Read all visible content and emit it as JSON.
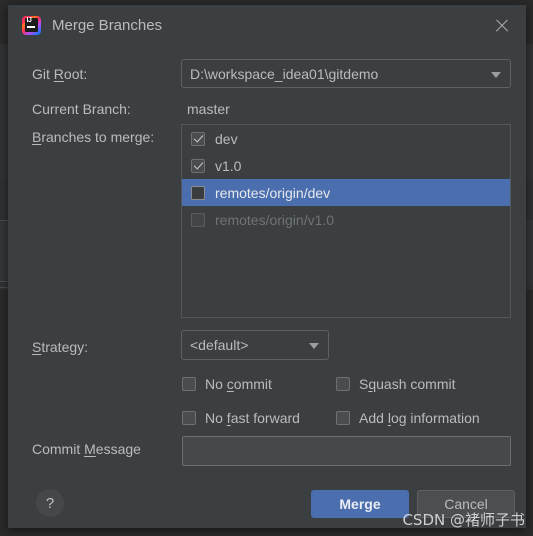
{
  "dialog": {
    "title": "Merge Branches",
    "icon": "intellij-idea-icon",
    "close_icon": "close-icon",
    "help_label": "?"
  },
  "fields": {
    "git_root": {
      "label_pre": "Git ",
      "label_mnemonic": "R",
      "label_post": "oot:",
      "value": "D:\\workspace_idea01\\gitdemo"
    },
    "current_branch": {
      "label": "Current Branch:",
      "value": "master"
    },
    "branches_to_merge": {
      "label_pre": "",
      "label_mnemonic": "B",
      "label_post": "ranches to merge:"
    },
    "strategy": {
      "label_pre": "",
      "label_mnemonic": "S",
      "label_post": "trategy:",
      "value": "<default>"
    },
    "commit_message": {
      "label_pre": "Commit ",
      "label_mnemonic": "M",
      "label_post": "essage",
      "value": "",
      "placeholder": ""
    }
  },
  "branches": [
    {
      "name": "dev",
      "checked": true,
      "selected": false,
      "disabled": false
    },
    {
      "name": "v1.0",
      "checked": true,
      "selected": false,
      "disabled": false
    },
    {
      "name": "remotes/origin/dev",
      "checked": false,
      "selected": true,
      "disabled": false
    },
    {
      "name": "remotes/origin/v1.0",
      "checked": false,
      "selected": false,
      "disabled": true
    }
  ],
  "options": [
    {
      "pre": "No ",
      "mnemonic": "c",
      "post": "ommit",
      "checked": false
    },
    {
      "pre": "S",
      "mnemonic": "q",
      "post": "uash commit",
      "checked": false
    },
    {
      "pre": "No ",
      "mnemonic": "f",
      "post": "ast forward",
      "checked": false
    },
    {
      "pre": "Add ",
      "mnemonic": "l",
      "post": "og information",
      "checked": false
    }
  ],
  "buttons": {
    "merge": "Merge",
    "cancel": "Cancel"
  },
  "watermark": "CSDN @褚师子书",
  "colors": {
    "dialog_bg": "#3c3f41",
    "accent": "#4b6eaf",
    "text": "#bbbbbb",
    "disabled_text": "#6f7376",
    "field_bg": "#45494a",
    "border": "#5e6163"
  }
}
